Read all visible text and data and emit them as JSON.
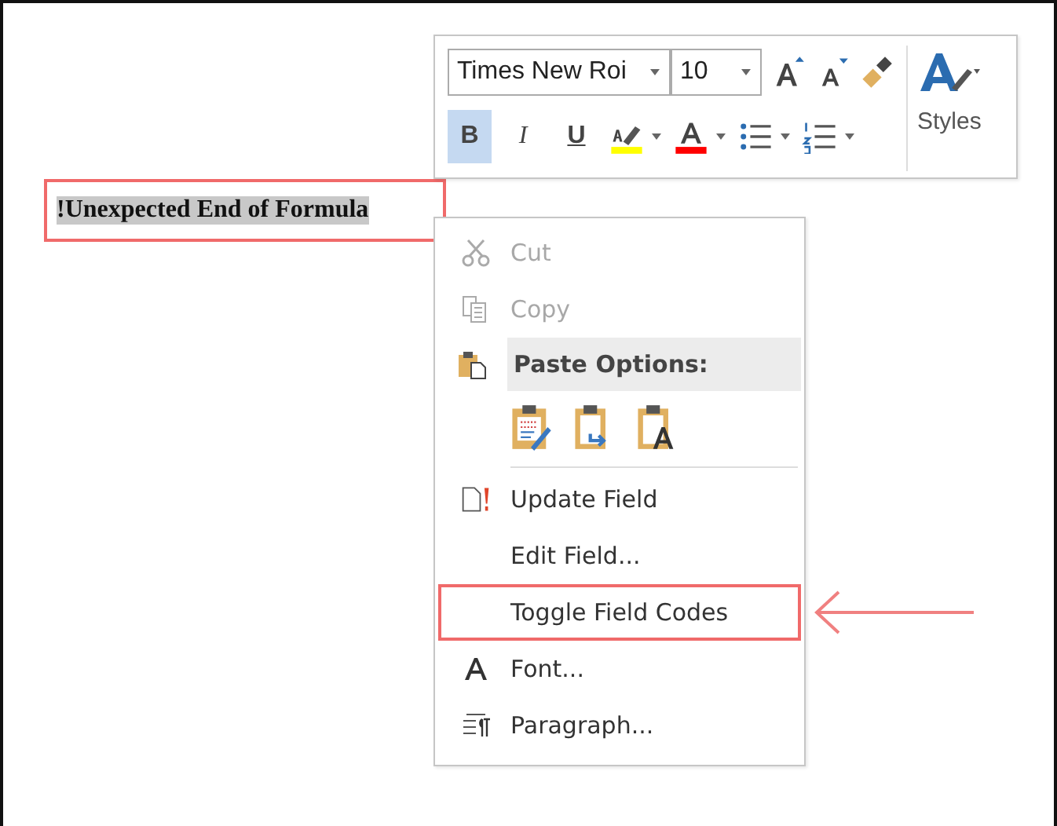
{
  "field_text": {
    "text": "!Unexpected End of Formula",
    "selected": true,
    "highlighted": true
  },
  "mini_toolbar": {
    "font_name": "Times New Roi",
    "font_size": "10",
    "bold": {
      "label": "B",
      "selected": true
    },
    "italic": {
      "label": "I",
      "selected": false
    },
    "underline": {
      "label": "U",
      "selected": false
    },
    "styles_label": "Styles"
  },
  "context_menu": {
    "items": [
      {
        "kind": "item",
        "label": "Cut",
        "disabled": true,
        "highlighted": false
      },
      {
        "kind": "item",
        "label": "Copy",
        "disabled": true,
        "highlighted": false
      },
      {
        "kind": "header",
        "label": "Paste Options:"
      },
      {
        "kind": "paste-icons"
      },
      {
        "kind": "item",
        "label": "Update Field",
        "disabled": false,
        "highlighted": false
      },
      {
        "kind": "item",
        "label": "Edit Field...",
        "disabled": false,
        "highlighted": false
      },
      {
        "kind": "item",
        "label": "Toggle Field Codes",
        "disabled": false,
        "highlighted": true
      },
      {
        "kind": "item",
        "label": "Font...",
        "disabled": false,
        "highlighted": false
      },
      {
        "kind": "item",
        "label": "Paragraph...",
        "disabled": false,
        "highlighted": false
      }
    ]
  }
}
